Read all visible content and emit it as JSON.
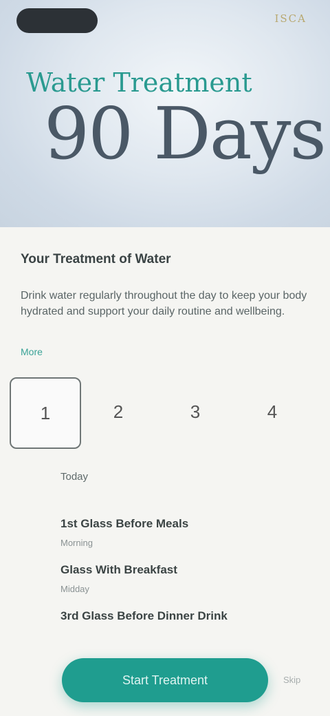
{
  "hero": {
    "mark": "ISCA",
    "kicker": "Water Treatment",
    "headline": "90 Days"
  },
  "program": {
    "title": "Your Treatment of Water",
    "description": "Drink water regularly throughout the day to keep your body hydrated and support your daily routine and wellbeing.",
    "more_label": "More"
  },
  "steps": [
    {
      "label": "1"
    },
    {
      "label": "2"
    },
    {
      "label": "3"
    },
    {
      "label": "4"
    }
  ],
  "schedule": {
    "label": "Today",
    "items": [
      {
        "title": "1st Glass Before Meals",
        "subtitle": "Morning"
      },
      {
        "title": "Glass With Breakfast",
        "subtitle": "Midday"
      },
      {
        "title": "3rd Glass Before Dinner Drink",
        "subtitle": ""
      }
    ]
  },
  "cta": {
    "label": "Start Treatment"
  },
  "aux": {
    "label": "Skip"
  },
  "colors": {
    "accent": "#1f9d8f",
    "headline": "#4a5866",
    "kicker": "#2a9a90"
  }
}
